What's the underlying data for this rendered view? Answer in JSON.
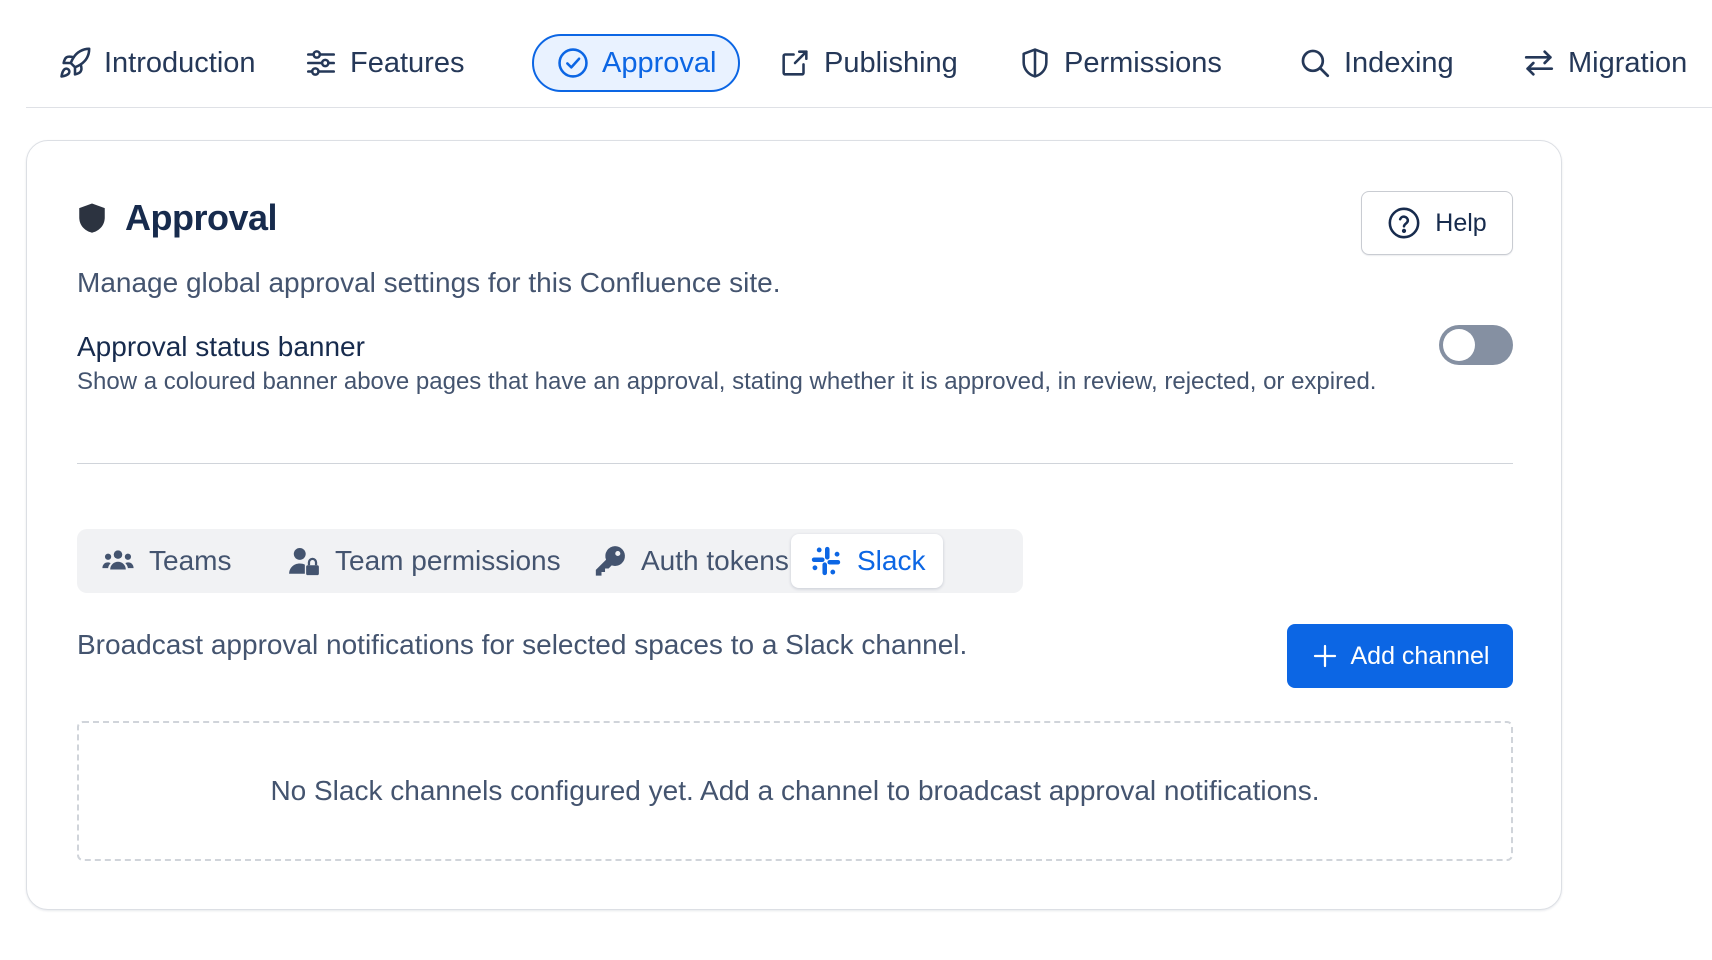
{
  "nav": {
    "tabs": [
      {
        "label": "Introduction",
        "icon": "rocket-icon"
      },
      {
        "label": "Features",
        "icon": "sliders-icon"
      },
      {
        "label": "Approval",
        "icon": "check-circle-icon",
        "active": true
      },
      {
        "label": "Publishing",
        "icon": "share-icon"
      },
      {
        "label": "Permissions",
        "icon": "shield-icon"
      },
      {
        "label": "Indexing",
        "icon": "search-icon"
      },
      {
        "label": "Migration",
        "icon": "arrows-swap-icon"
      }
    ]
  },
  "card": {
    "title": "Approval",
    "help_label": "Help",
    "subtitle": "Manage global approval settings for this Confluence site.",
    "setting": {
      "title": "Approval status banner",
      "description": "Show a coloured banner above pages that have an approval, stating whether it is approved, in review, rejected, or expired.",
      "enabled": false
    },
    "subtabs": [
      {
        "label": "Teams",
        "icon": "people-group-icon"
      },
      {
        "label": "Team permissions",
        "icon": "user-lock-icon"
      },
      {
        "label": "Auth tokens",
        "icon": "key-icon"
      },
      {
        "label": "Slack",
        "icon": "slack-icon",
        "active": true
      }
    ],
    "slack": {
      "description": "Broadcast approval notifications for selected spaces to a Slack channel.",
      "add_label": "Add channel",
      "empty_message": "No Slack channels configured yet. Add a channel to broadcast approval notifications."
    }
  },
  "colors": {
    "accent": "#0c66e4",
    "accent_bg": "#e9f2ff",
    "text": "#172b4d",
    "subtle_text": "#44546f",
    "toggle_off": "#8590a2"
  }
}
